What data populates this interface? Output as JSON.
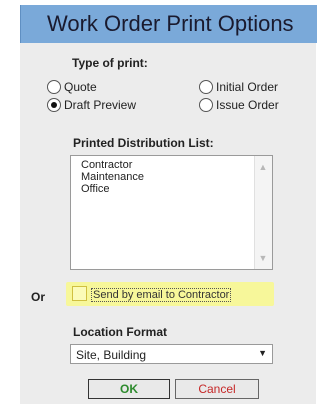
{
  "window": {
    "title": "Work Order Print Options"
  },
  "type_of_print": {
    "label": "Type of print:",
    "options": [
      {
        "label": "Quote",
        "checked": false
      },
      {
        "label": "Draft Preview",
        "checked": true
      },
      {
        "label": "Initial Order",
        "checked": false
      },
      {
        "label": "Issue Order",
        "checked": false
      }
    ]
  },
  "distribution": {
    "label": "Printed Distribution List:",
    "items": [
      "Contractor",
      "Maintenance",
      "Office"
    ]
  },
  "email": {
    "or_label": "Or",
    "label": "Send by email to Contractor",
    "checked": false,
    "highlight_color": "#f7f79a"
  },
  "location_format": {
    "label": "Location Format",
    "selected": "Site, Building"
  },
  "buttons": {
    "ok": "OK",
    "cancel": "Cancel"
  },
  "colors": {
    "titlebar": "#7aa9d9",
    "dialog_bg": "#ececec",
    "ok_text": "#2e8b2e",
    "cancel_text": "#c62828"
  }
}
